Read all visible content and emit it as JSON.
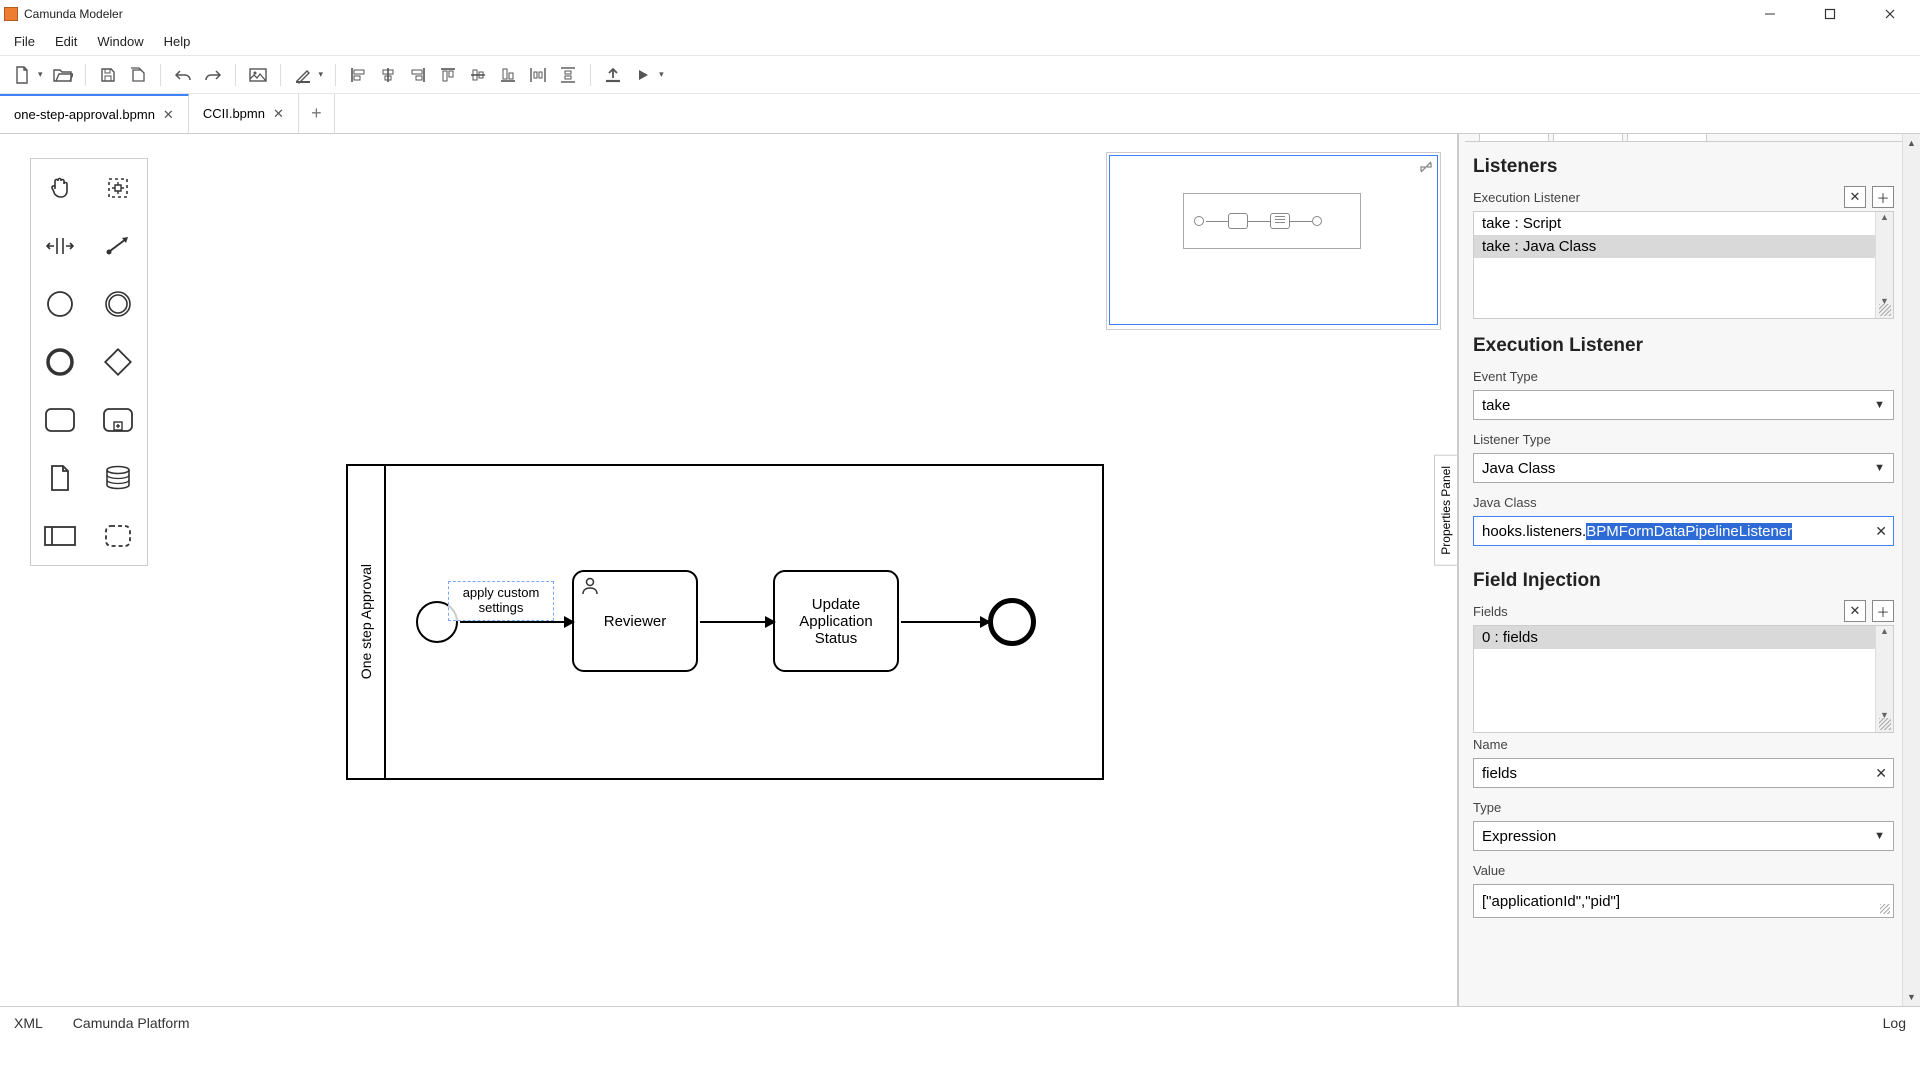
{
  "window": {
    "title": "Camunda Modeler"
  },
  "menu": [
    "File",
    "Edit",
    "Window",
    "Help"
  ],
  "tabs": [
    {
      "label": "one-step-approval.bpmn",
      "active": true
    },
    {
      "label": "CCII.bpmn",
      "active": false
    }
  ],
  "diagram": {
    "pool_label": "One step Approval",
    "seq_label_line1": "apply custom",
    "seq_label_line2": "settings",
    "task1": "Reviewer",
    "task2_l1": "Update",
    "task2_l2": "Application",
    "task2_l3": "Status"
  },
  "panel": {
    "tab_label": "Properties Panel",
    "listeners_title": "Listeners",
    "exec_listener_label": "Execution Listener",
    "exec_items": [
      "take : Script",
      "take : Java Class"
    ],
    "exec_section_title": "Execution Listener",
    "event_type_label": "Event Type",
    "event_type_value": "take",
    "listener_type_label": "Listener Type",
    "listener_type_value": "Java Class",
    "java_class_label": "Java Class",
    "java_class_prefix": "hooks.listeners.",
    "java_class_sel": "BPMFormDataPipelineListener",
    "field_inj_title": "Field Injection",
    "fields_label": "Fields",
    "fields_items": [
      "0 : fields"
    ],
    "name_label": "Name",
    "name_value": "fields",
    "type_label": "Type",
    "type_value": "Expression",
    "value_label": "Value",
    "value_value": "[\"applicationId\",\"pid\"]"
  },
  "status": {
    "left1": "XML",
    "left2": "Camunda Platform",
    "right": "Log"
  }
}
